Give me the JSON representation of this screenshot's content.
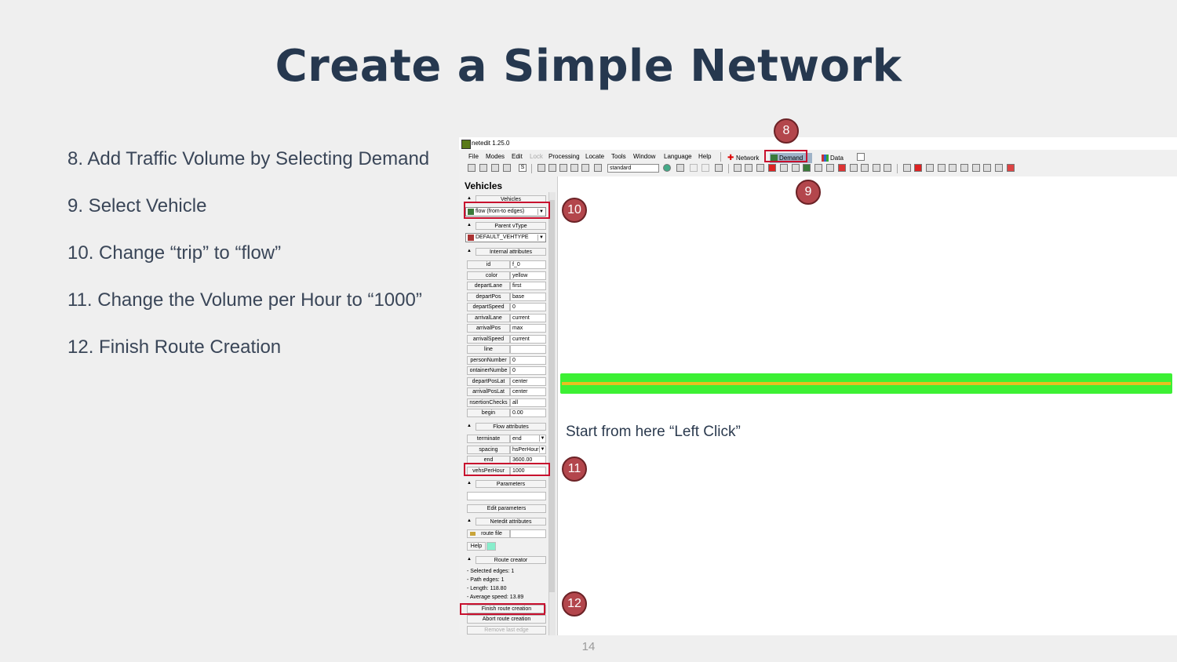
{
  "slide": {
    "title": "Create a Simple Network",
    "page_number": "14",
    "steps": [
      "8. Add Traffic Volume by Selecting Demand",
      "9. Select Vehicle",
      "10. Change “trip” to “flow”",
      "11. Change the Volume per Hour to “1000”",
      "12. Finish Route Creation"
    ],
    "badges": [
      "8",
      "9",
      "10",
      "11",
      "12"
    ]
  },
  "app": {
    "title": "netedit 1.25.0",
    "menu": [
      "File",
      "Modes",
      "Edit",
      "Lock",
      "Processing",
      "Locate",
      "Tools",
      "Window",
      "Language",
      "Help"
    ],
    "supermodes": {
      "network": "Network",
      "demand": "Demand",
      "data": "Data"
    },
    "scheme_select": "standard",
    "toolbar_s": "S"
  },
  "panel": {
    "title": "Vehicles",
    "vehicles_header": "Vehicles",
    "vehicle_type_value": "flow (from-to edges)",
    "parent_vtype_header": "Parent vType",
    "parent_vtype_value": "DEFAULT_VEHTYPE",
    "internal_header": "Internal attributes",
    "attributes": [
      {
        "name": "id",
        "value": "f_0"
      },
      {
        "name": "color",
        "value": "yellow"
      },
      {
        "name": "departLane",
        "value": "first"
      },
      {
        "name": "departPos",
        "value": "base"
      },
      {
        "name": "departSpeed",
        "value": "0"
      },
      {
        "name": "arrivalLane",
        "value": "current"
      },
      {
        "name": "arrivalPos",
        "value": "max"
      },
      {
        "name": "arrivalSpeed",
        "value": "current"
      },
      {
        "name": "line",
        "value": ""
      },
      {
        "name": "personNumber",
        "value": "0"
      },
      {
        "name": "ontainerNumbe",
        "value": "0"
      },
      {
        "name": "departPosLat",
        "value": "center"
      },
      {
        "name": "arrivalPosLat",
        "value": "center"
      },
      {
        "name": "nsertionChecks",
        "value": "all"
      },
      {
        "name": "begin",
        "value": "0.00"
      }
    ],
    "flow_header": "Flow attributes",
    "flow_attributes": [
      {
        "name": "terminate",
        "value": "end"
      },
      {
        "name": "spacing",
        "value": "hsPerHour"
      },
      {
        "name": "end",
        "value": "3600.00"
      },
      {
        "name": "vehsPerHour",
        "value": "1000"
      }
    ],
    "parameters_header": "Parameters",
    "edit_parameters": "Edit parameters",
    "netedit_header": "Netedit attributes",
    "route_file_label": "route file",
    "help_label": "Help",
    "route_creator_header": "Route creator",
    "route_info": [
      "- Selected edges: 1",
      "- Path edges: 1",
      "- Length: 118.80",
      "- Average speed: 13.89"
    ],
    "finish_button": "Finish route creation",
    "abort_button": "Abort route creation",
    "remove_button": "Remove last edge"
  },
  "canvas": {
    "note": "Start from here “Left Click”"
  },
  "colors": {
    "title": "#26384f",
    "highlight": "#c8102e",
    "badge": "#b3464c",
    "edge_green": "#3cf034",
    "edge_yellow": "#e7c020"
  }
}
